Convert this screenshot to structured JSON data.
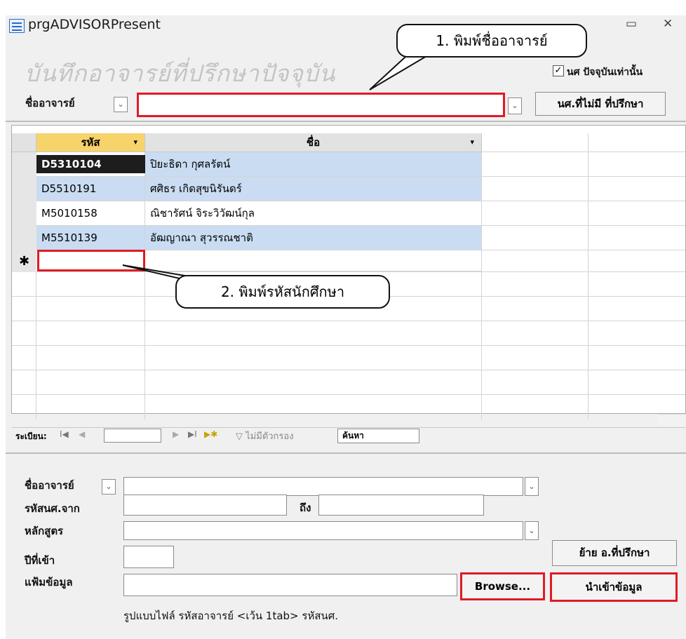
{
  "window": {
    "title": "prgADVISORPresent",
    "minimize_icon": "minimize-icon",
    "close_icon": "close-icon"
  },
  "heading": "บันทึกอาจารย์ที่ปรึกษาปัจจุบัน",
  "filter": {
    "current_only_label": "นศ ปัจจุบันเท่านั้น",
    "current_only_checked": true,
    "checkmark": "✓"
  },
  "top": {
    "advisor_label": "ชื่ออาจารย์",
    "advisor_value": "",
    "no_advisor_button": "นศ.ที่ไม่มี ที่ปรึกษา"
  },
  "grid": {
    "columns": [
      "รหัส",
      "ชื่อ"
    ],
    "rows": [
      {
        "code": "D5310104",
        "name": "ปิยะธิดา  กุศลรัตน์"
      },
      {
        "code": "D5510191",
        "name": "ศศิธร  เกิดสุขนิรันดร์"
      },
      {
        "code": "M5010158",
        "name": "ณิชารัศน์  จิระวิวัฒน์กุล"
      },
      {
        "code": "M5510139",
        "name": "อัฒญาณา  สุวรรณชาติ"
      }
    ],
    "new_row_marker": "✱"
  },
  "navigator": {
    "record_label": "ระเบียน:",
    "first": "I◀",
    "prev": "◀",
    "next": "▶",
    "last": "▶I",
    "new": "▶✱",
    "no_filter": "ไม่มีตัวกรอง",
    "search": "ค้นหา"
  },
  "callouts": {
    "one": "1. พิมพ์ชื่ออาจารย์",
    "two": "2. พิมพ์รหัสนักศึกษา"
  },
  "bottom": {
    "advisor_label": "ชื่ออาจารย์",
    "code_from_label": "รหัสนศ.จาก",
    "to_label": "ถึง",
    "curriculum_label": "หลักสูตร",
    "year_label": "ปีที่เข้า",
    "file_label": "แฟ้มข้อมูล",
    "move_button": "ย้าย อ.ที่ปรึกษา",
    "browse_button": "Browse...",
    "import_button": "นำเข้าข้อมูล",
    "format_note": "รูปแบบไฟล์  รหัสอาจารย์ <เว้น 1tab> รหัสนศ."
  },
  "colors": {
    "highlight_red": "#e01b24",
    "selected_row": "#c9dcf2",
    "sort_header": "#f7d36b"
  }
}
